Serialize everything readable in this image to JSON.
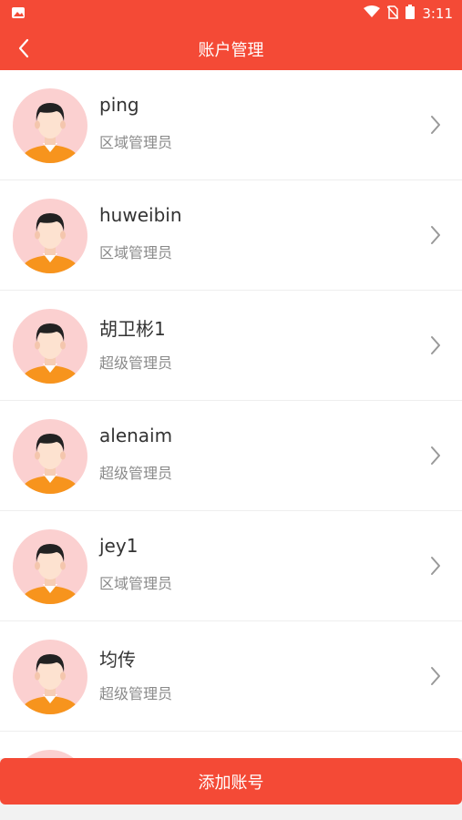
{
  "status_bar": {
    "time": "3:11",
    "icons": [
      "image-icon",
      "wifi-icon",
      "no-sim-icon",
      "battery-icon"
    ]
  },
  "header": {
    "title": "账户管理",
    "back_icon": "chevron-left-icon"
  },
  "accounts": [
    {
      "name": "ping",
      "role": "区域管理员"
    },
    {
      "name": "huweibin",
      "role": "区域管理员"
    },
    {
      "name": "胡卫彬1",
      "role": "超级管理员"
    },
    {
      "name": "alenaim",
      "role": "超级管理员"
    },
    {
      "name": "jey1",
      "role": "区域管理员"
    },
    {
      "name": "均传",
      "role": "超级管理员"
    }
  ],
  "add_button": {
    "label": "添加账号"
  },
  "colors": {
    "brand": "#f44a36",
    "avatar_bg": "#fbd0d0",
    "shirt": "#f7941d"
  }
}
